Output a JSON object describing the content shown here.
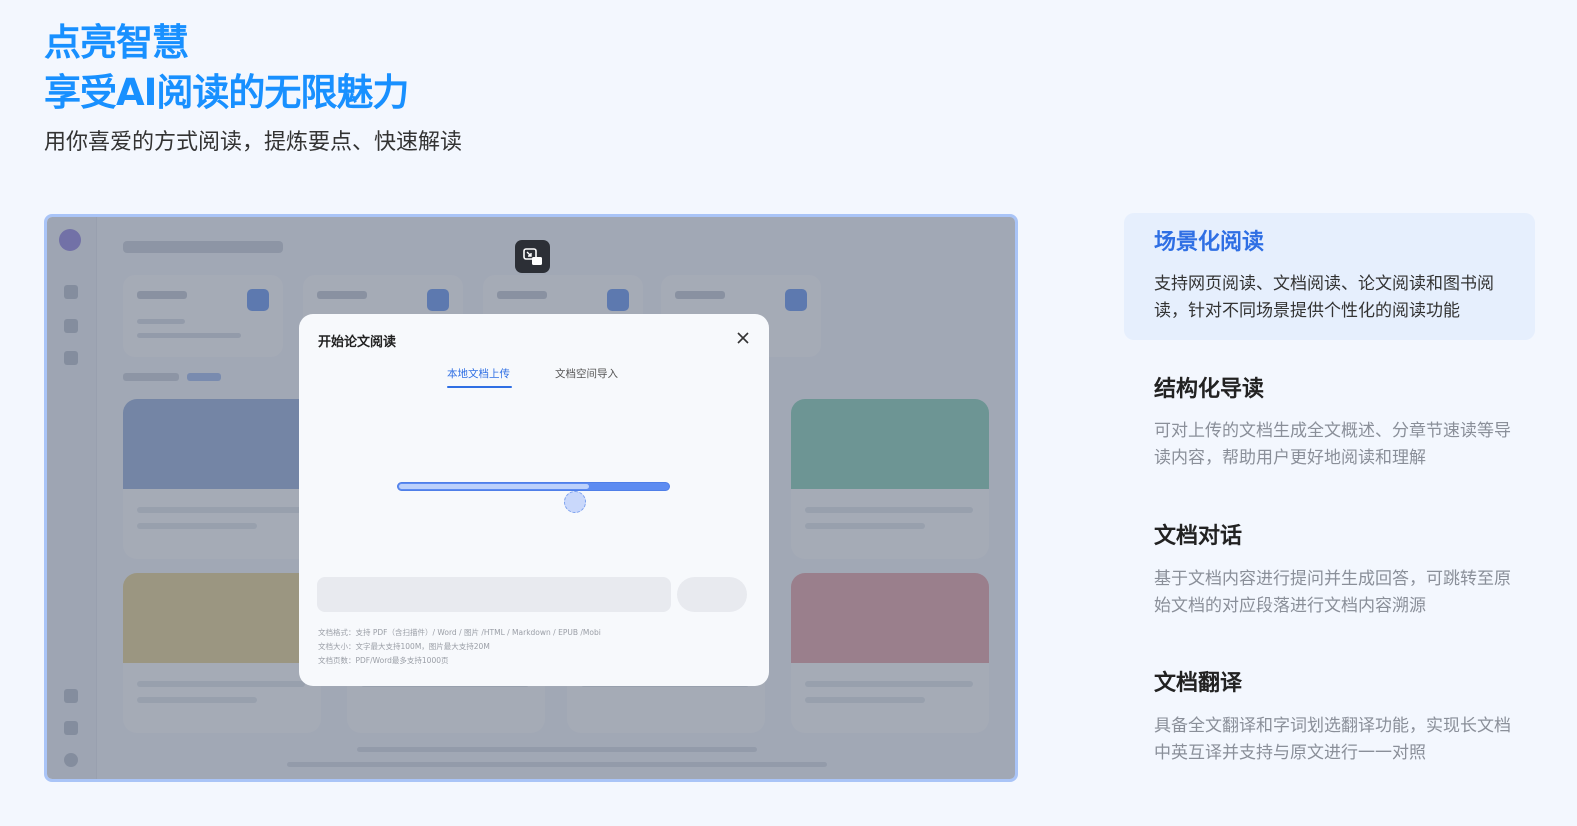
{
  "hero": {
    "line1": "点亮智慧",
    "line2": "享受AI阅读的无限魅力",
    "subtitle": "用你喜爱的方式阅读，提炼要点、快速解读"
  },
  "modal": {
    "title": "开始论文阅读",
    "tabs": [
      {
        "label": "本地文档上传",
        "active": true
      },
      {
        "label": "文档空间导入",
        "active": false
      }
    ],
    "progress": 0.7,
    "notes": [
      "文档格式：支持 PDF（含扫描件）/ Word / 图片 /HTML / Markdown / EPUB /Mobi",
      "文档大小：文字最大支持100M，图片最大支持20M",
      "文档页数：PDF/Word最多支持1000页"
    ]
  },
  "features": [
    {
      "title": "场景化阅读",
      "desc": "支持网页阅读、文档阅读、论文阅读和图书阅读，针对不同场景提供个性化的阅读功能",
      "active": true
    },
    {
      "title": "结构化导读",
      "desc": "可对上传的文档生成全文概述、分章节速读等导读内容，帮助用户更好地阅读和理解",
      "active": false
    },
    {
      "title": "文档对话",
      "desc": "基于文档内容进行提问并生成回答，可跳转至原始文档的对应段落进行文档内容溯源",
      "active": false
    },
    {
      "title": "文档翻译",
      "desc": "具备全文翻译和字词划选翻译功能，实现长文档中英互译并支持与原文进行一一对照",
      "active": false
    }
  ],
  "colors": {
    "accent": "#1890ff",
    "active_title": "#2f6fe4",
    "active_bg": "#e6effd",
    "doc_card_tops": [
      "#8fa9d8",
      "#7fcdb2",
      "#e8cf86",
      "#e59c9f"
    ]
  }
}
